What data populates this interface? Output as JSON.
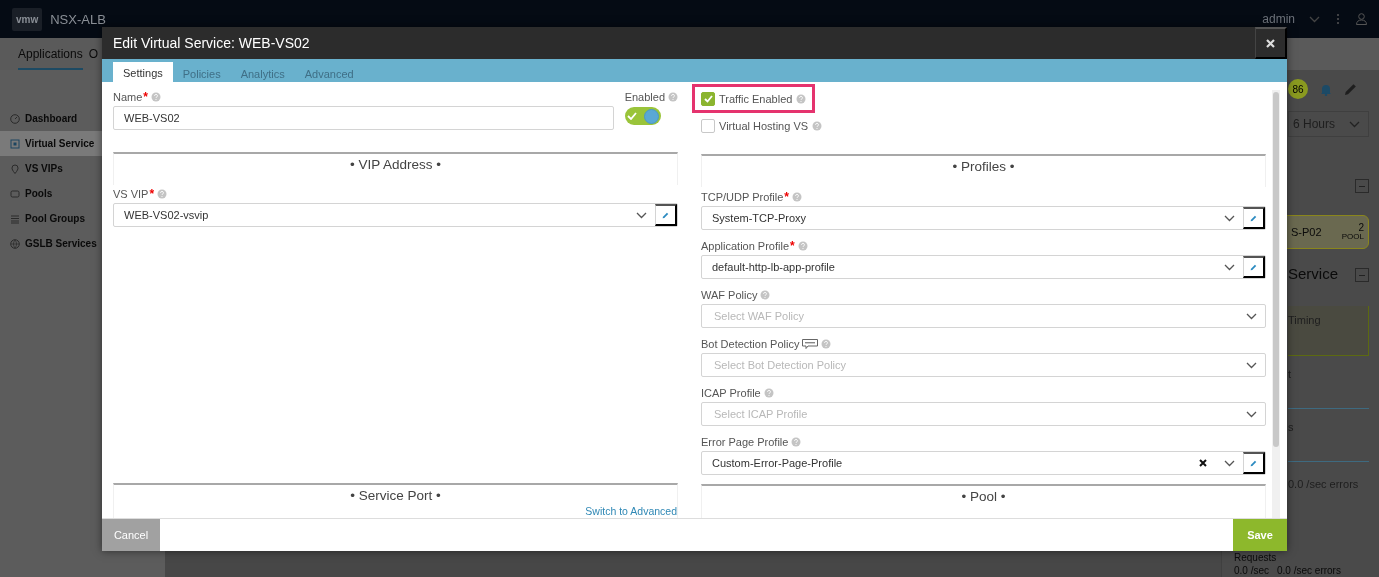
{
  "topbar": {
    "logo": "vmw",
    "product": "NSX-ALB",
    "user": "admin"
  },
  "nav_tabs": [
    {
      "label": "Applications",
      "selected": true
    },
    {
      "label": "O",
      "selected": false
    }
  ],
  "sidebar": {
    "items": [
      {
        "label": "Dashboard",
        "kind": "gauge",
        "selected": false
      },
      {
        "label": "Virtual Service",
        "kind": "grid",
        "selected": true
      },
      {
        "label": "VS VIPs",
        "kind": "pin",
        "selected": false
      },
      {
        "label": "Pools",
        "kind": "pool",
        "selected": false
      },
      {
        "label": "Pool Groups",
        "kind": "list",
        "selected": false
      },
      {
        "label": "GSLB Services",
        "kind": "globe",
        "selected": false
      }
    ]
  },
  "detail_panel": {
    "health_score": "86",
    "time_range": "6 Hours",
    "pool_card": {
      "name": "S-P02",
      "count": "2",
      "type": "POOL"
    },
    "heading": "Service",
    "timing_card": "Timing",
    "chart_labels": [
      "t",
      "s"
    ],
    "errors_reading": "0.0 /sec errors",
    "requests": {
      "title": "Requests",
      "rate": "0.0 /sec",
      "errors": "0.0 /sec errors"
    }
  },
  "dialog": {
    "title": "Edit Virtual Service: WEB-VS02",
    "tabs": [
      {
        "label": "Settings",
        "selected": true
      },
      {
        "label": "Policies",
        "selected": false
      },
      {
        "label": "Analytics",
        "selected": false
      },
      {
        "label": "Advanced",
        "selected": false
      }
    ],
    "left_column": {
      "name_field": {
        "label": "Name",
        "required_mark": "*",
        "value": "WEB-VS02"
      },
      "enabled_toggle": {
        "label": "Enabled",
        "on": true
      },
      "vip_section": "• VIP Address •",
      "vs_vip": {
        "label": "VS VIP",
        "required_mark": "*",
        "value": "WEB-VS02-vsvip",
        "editable": true,
        "clearable": false,
        "beta": false
      },
      "service_port_section": "• Service Port •",
      "switch_link": "Switch to Advanced"
    },
    "right_column": {
      "checkboxes": [
        {
          "label": "Traffic Enabled",
          "checked": true,
          "highlighted": true
        },
        {
          "label": "Virtual Hosting VS",
          "checked": false,
          "highlighted": false
        }
      ],
      "profiles_section": "• Profiles •",
      "fields": [
        {
          "label": "TCP/UDP Profile",
          "required_mark": "*",
          "value": "System-TCP-Proxy",
          "editable": true,
          "clearable": false,
          "beta": false
        },
        {
          "label": "Application Profile",
          "required_mark": "*",
          "value": "default-http-lb-app-profile",
          "editable": true,
          "clearable": false,
          "beta": false
        },
        {
          "label": "WAF Policy",
          "placeholder": "Select WAF Policy",
          "editable": false,
          "clearable": false,
          "beta": false
        },
        {
          "label": "Bot Detection Policy",
          "placeholder": "Select Bot Detection Policy",
          "editable": false,
          "clearable": false,
          "beta": true
        },
        {
          "label": "ICAP Profile",
          "placeholder": "Select ICAP Profile",
          "editable": false,
          "clearable": false,
          "beta": false
        },
        {
          "label": "Error Page Profile",
          "value": "Custom-Error-Page-Profile",
          "editable": true,
          "clearable": true,
          "beta": false
        }
      ],
      "pool_section": "• Pool •"
    },
    "footer": {
      "cancel": "Cancel",
      "save": "Save"
    }
  }
}
